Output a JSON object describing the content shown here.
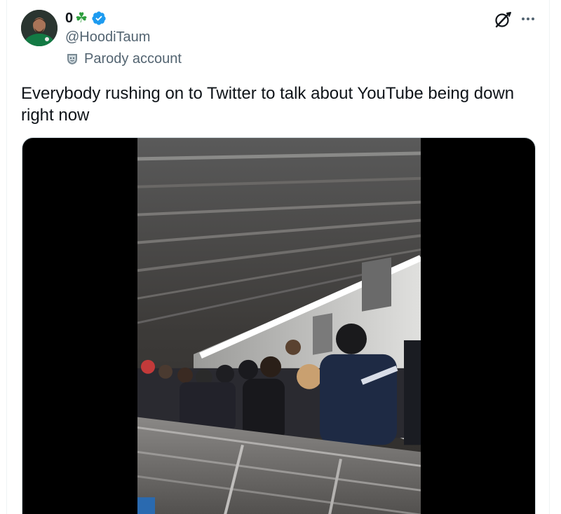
{
  "tweet": {
    "author": {
      "display_name": "0",
      "emoji": "☘",
      "handle": "@HoodiTaum",
      "verified": true,
      "label": "Parody account"
    },
    "text": "Everybody rushing on to Twitter to talk about YouTube being down right now",
    "media": {
      "type": "video",
      "description_icon": "video-thumbnail"
    }
  },
  "icons": {
    "verified": "verified-badge-icon",
    "parody": "theater-mask-icon",
    "grok": "grok-icon",
    "more": "more-horizontal-icon"
  },
  "colors": {
    "verified_blue": "#1d9bf0",
    "secondary_text": "#536471",
    "primary_text": "#0f1419",
    "shamrock_green": "#2e9e3e"
  }
}
